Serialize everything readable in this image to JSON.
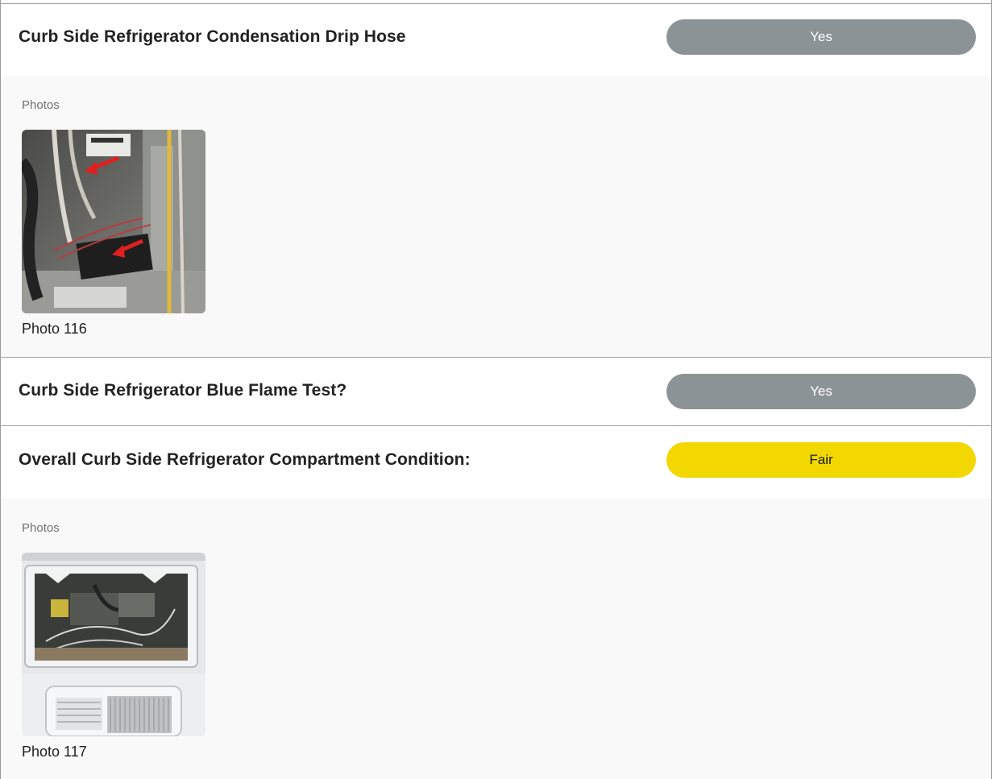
{
  "sections": [
    {
      "title": "Curb Side Refrigerator Condensation Drip Hose",
      "answer": "Yes",
      "answer_color": "#8c9397",
      "photos_label": "Photos",
      "photos": [
        {
          "caption": "Photo 116"
        }
      ]
    },
    {
      "title": "Curb Side Refrigerator Blue Flame Test?",
      "answer": "Yes",
      "answer_color": "#8c9397"
    },
    {
      "title": "Overall Curb Side Refrigerator Compartment Condition:",
      "answer": "Fair",
      "answer_color": "#f2d800",
      "photos_label": "Photos",
      "photos": [
        {
          "caption": "Photo 117"
        }
      ]
    }
  ]
}
